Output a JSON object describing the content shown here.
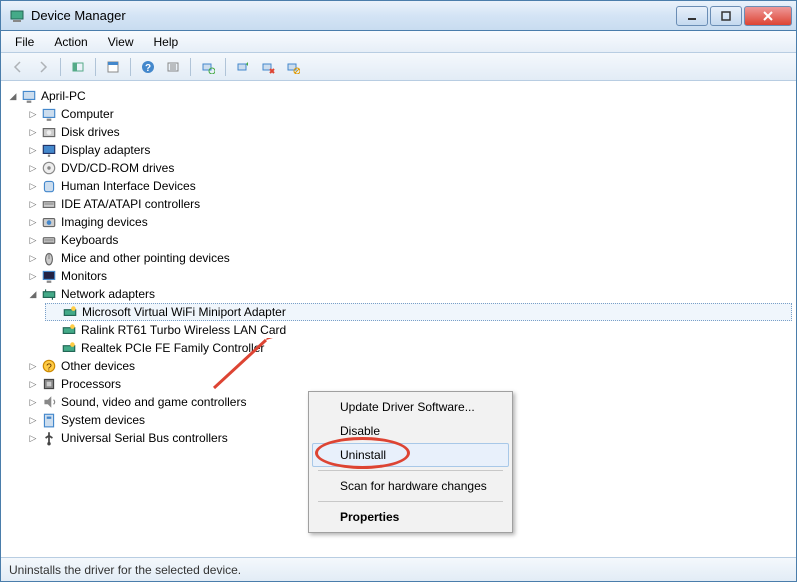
{
  "window": {
    "title": "Device Manager"
  },
  "menubar": {
    "items": [
      "File",
      "Action",
      "View",
      "Help"
    ]
  },
  "tree": {
    "root": {
      "label": "April-PC",
      "expanded": true
    },
    "categories": [
      {
        "label": "Computer",
        "expanded": false
      },
      {
        "label": "Disk drives",
        "expanded": false
      },
      {
        "label": "Display adapters",
        "expanded": false
      },
      {
        "label": "DVD/CD-ROM drives",
        "expanded": false
      },
      {
        "label": "Human Interface Devices",
        "expanded": false
      },
      {
        "label": "IDE ATA/ATAPI controllers",
        "expanded": false
      },
      {
        "label": "Imaging devices",
        "expanded": false
      },
      {
        "label": "Keyboards",
        "expanded": false
      },
      {
        "label": "Mice and other pointing devices",
        "expanded": false
      },
      {
        "label": "Monitors",
        "expanded": false
      },
      {
        "label": "Network adapters",
        "expanded": true,
        "children": [
          {
            "label": "Microsoft Virtual WiFi Miniport Adapter",
            "selected": true
          },
          {
            "label": "Ralink RT61 Turbo Wireless LAN Card",
            "selected": false
          },
          {
            "label": "Realtek PCIe FE Family Controller",
            "selected": false
          }
        ]
      },
      {
        "label": "Other devices",
        "expanded": false
      },
      {
        "label": "Processors",
        "expanded": false
      },
      {
        "label": "Sound, video and game controllers",
        "expanded": false
      },
      {
        "label": "System devices",
        "expanded": false
      },
      {
        "label": "Universal Serial Bus controllers",
        "expanded": false
      }
    ]
  },
  "context_menu": {
    "items": [
      {
        "label": "Update Driver Software...",
        "type": "item"
      },
      {
        "label": "Disable",
        "type": "item"
      },
      {
        "label": "Uninstall",
        "type": "item",
        "highlighted": true
      },
      {
        "type": "sep"
      },
      {
        "label": "Scan for hardware changes",
        "type": "item"
      },
      {
        "type": "sep"
      },
      {
        "label": "Properties",
        "type": "item",
        "bold": true
      }
    ]
  },
  "statusbar": {
    "text": "Uninstalls the driver for the selected device."
  },
  "toolbar_icons": [
    "back-icon",
    "forward-icon",
    "show-hide-icon",
    "properties-icon",
    "help-icon",
    "action-icon",
    "scan-icon",
    "update-driver-icon",
    "uninstall-icon",
    "disable-icon"
  ],
  "category_icons": [
    "computer-icon",
    "disk-icon",
    "display-icon",
    "dvd-icon",
    "hid-icon",
    "ide-icon",
    "imaging-icon",
    "keyboard-icon",
    "mouse-icon",
    "monitor-icon",
    "network-icon",
    "other-icon",
    "processor-icon",
    "sound-icon",
    "system-icon",
    "usb-icon"
  ]
}
